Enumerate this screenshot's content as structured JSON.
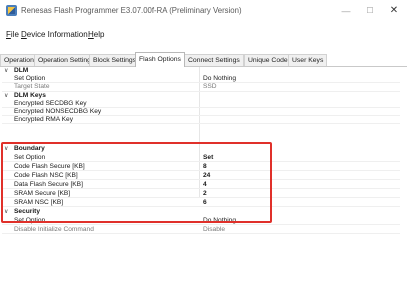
{
  "window": {
    "title": "Renesas Flash Programmer E3.07.00f-RA  (Preliminary Version)",
    "minimize_glyph": "—",
    "maximize_glyph": "☐",
    "close_glyph": "✕"
  },
  "menu": {
    "file": {
      "accel": "F",
      "rest": "ile"
    },
    "device": {
      "accel": "D",
      "rest": "evice Information"
    },
    "help": {
      "accel": "H",
      "rest": "elp"
    }
  },
  "tabs": [
    {
      "label": "Operation"
    },
    {
      "label": "Operation Settings"
    },
    {
      "label": "Block Settings"
    },
    {
      "label": "Flash Options"
    },
    {
      "label": "Connect Settings"
    },
    {
      "label": "Unique Code"
    },
    {
      "label": "User Keys"
    }
  ],
  "active_tab": "Flash Options",
  "sections": {
    "dlm": {
      "name": "DLM",
      "rows": [
        {
          "name": "Set Option",
          "value": "Do Nothing"
        },
        {
          "name": "Target State",
          "value": "SSD"
        }
      ]
    },
    "dlm_keys": {
      "name": "DLM Keys",
      "rows": [
        {
          "name": "Encrypted SECDBG Key",
          "value": ""
        },
        {
          "name": "Encrypted NONSECDBG Key",
          "value": ""
        },
        {
          "name": "Encrypted RMA Key",
          "value": ""
        }
      ]
    },
    "boundary": {
      "name": "Boundary",
      "rows": [
        {
          "name": "Set Option",
          "value": "Set"
        },
        {
          "name": "Code Flash Secure [KB]",
          "value": "8"
        },
        {
          "name": "Code Flash NSC [KB]",
          "value": "24"
        },
        {
          "name": "Data Flash Secure [KB]",
          "value": "4"
        },
        {
          "name": "SRAM Secure [KB]",
          "value": "2"
        },
        {
          "name": "SRAM NSC [KB]",
          "value": "6"
        }
      ]
    },
    "security": {
      "name": "Security",
      "rows": [
        {
          "name": "Set Option",
          "value": "Do Nothing"
        },
        {
          "name": "Disable Initialize Command",
          "value": "Disable"
        }
      ]
    }
  },
  "chevron_glyph": "∨",
  "colors": {
    "highlight_border": "#e0302a",
    "active_tab_bg": "#ffffff",
    "inactive_tab_bg": "#f0f0f0"
  }
}
